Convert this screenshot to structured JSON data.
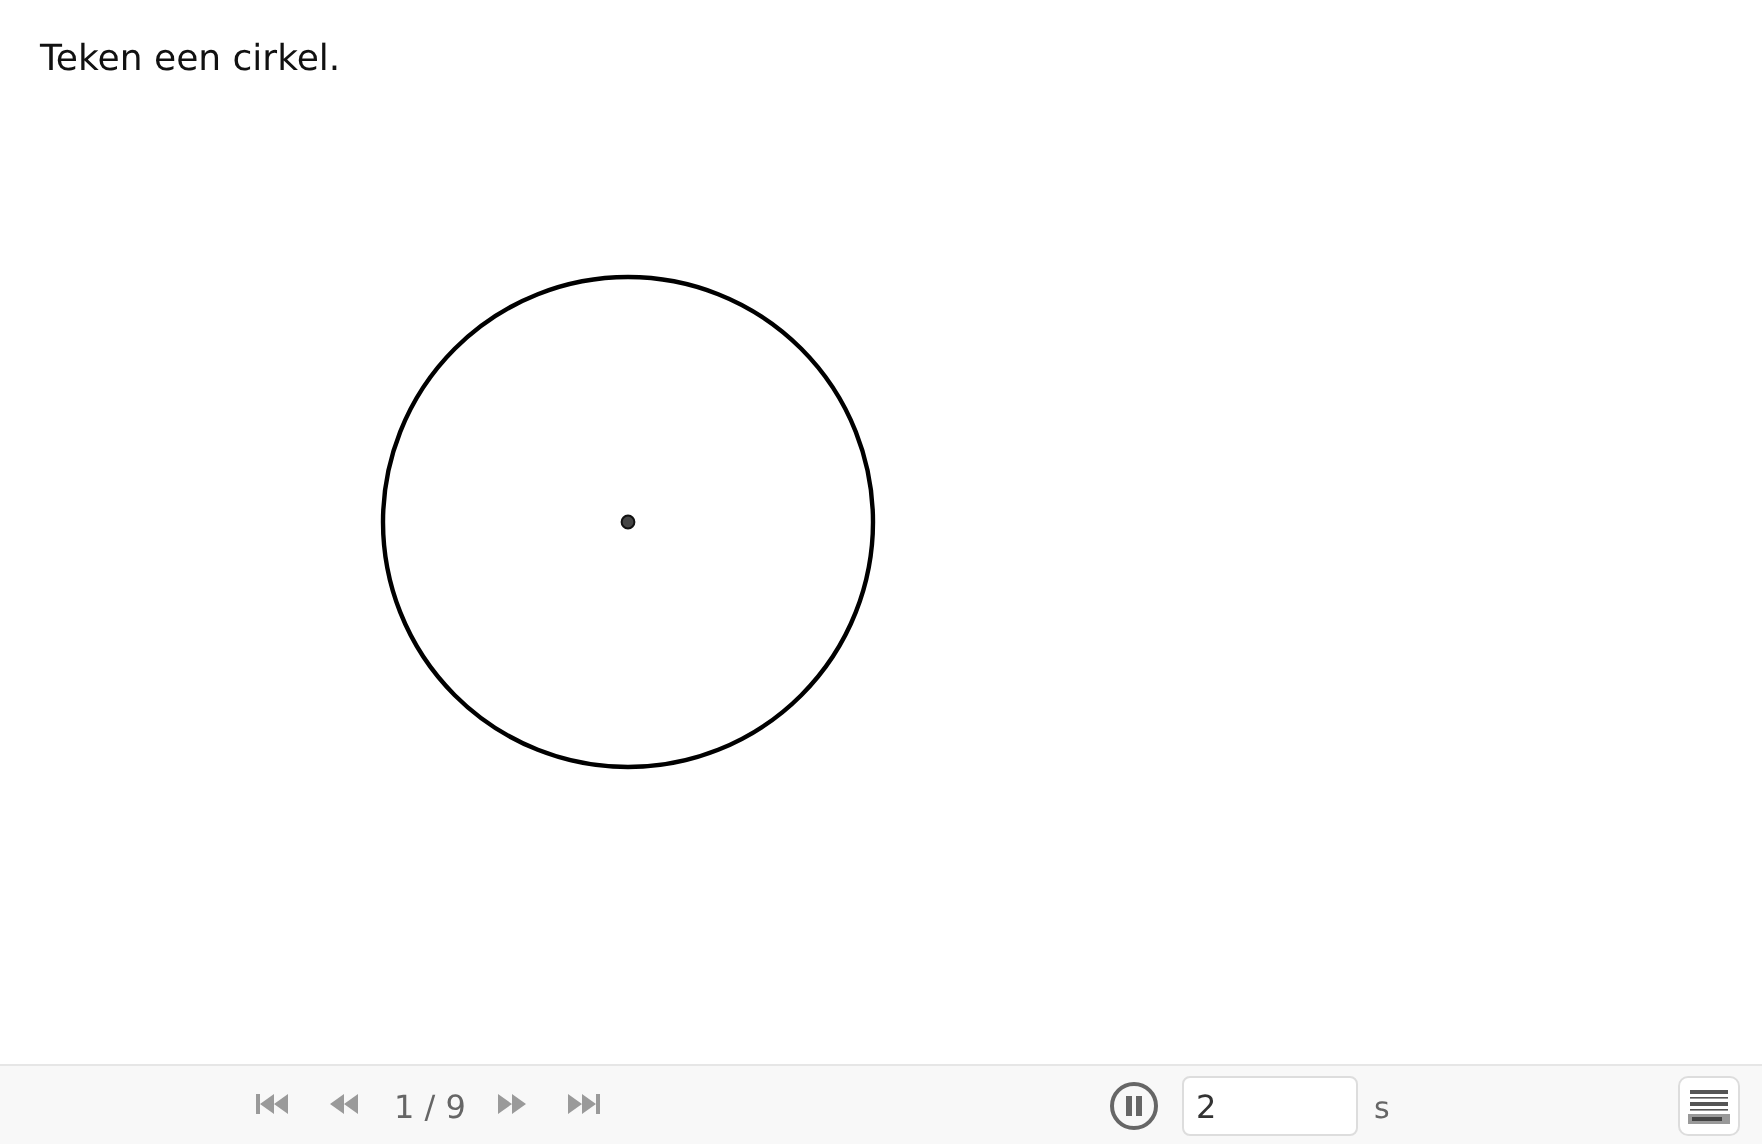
{
  "instruction": "Teken een cirkel.",
  "playback": {
    "step": "1 / 9",
    "playing": true,
    "interval": {
      "value": "2",
      "unit": "s"
    }
  }
}
